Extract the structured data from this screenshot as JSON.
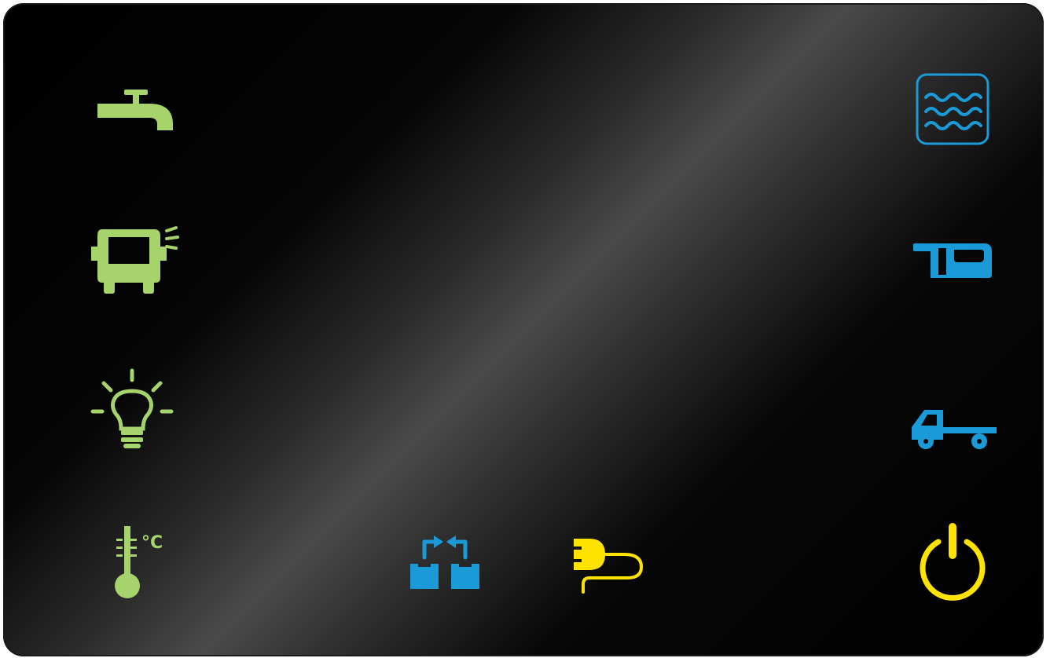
{
  "panel": {
    "colors": {
      "green": "#a7d36d",
      "blue": "#1a9ad6",
      "yellow": "#ffe300",
      "background": "#000000"
    },
    "left_column": [
      {
        "name": "water-tap-button",
        "icon": "water-tap-icon",
        "color": "green"
      },
      {
        "name": "vehicle-lights-button",
        "icon": "vehicle-headlight-icon",
        "color": "green"
      },
      {
        "name": "interior-light-button",
        "icon": "light-bulb-icon",
        "color": "green"
      },
      {
        "name": "temperature-button",
        "icon": "thermometer-icon",
        "color": "green"
      }
    ],
    "right_column": [
      {
        "name": "water-tank-button",
        "icon": "water-tank-icon",
        "color": "blue"
      },
      {
        "name": "caravan-battery-button",
        "icon": "caravan-icon",
        "color": "blue"
      },
      {
        "name": "vehicle-battery-button",
        "icon": "truck-icon",
        "color": "blue"
      },
      {
        "name": "power-button",
        "icon": "power-icon",
        "color": "yellow"
      }
    ],
    "bottom_row": [
      {
        "name": "battery-link-button",
        "icon": "battery-switch-icon",
        "color": "blue"
      },
      {
        "name": "shore-power-button",
        "icon": "plug-icon",
        "color": "yellow"
      }
    ],
    "temperature_unit": "°C"
  }
}
